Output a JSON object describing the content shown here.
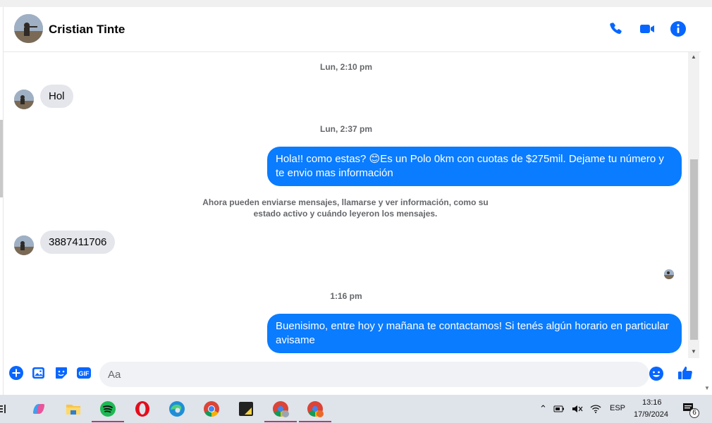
{
  "header": {
    "contact_name": "Cristian Tinte",
    "icons": [
      "phone-icon",
      "video-camera-icon",
      "info-icon"
    ]
  },
  "thread": {
    "timestamps": [
      "Lun, 2:10 pm",
      "Lun, 2:37 pm",
      "1:16 pm"
    ],
    "messages": [
      {
        "from": "contact",
        "text": "Hol"
      },
      {
        "from": "me",
        "text": "Hola!! como estas? 😊Es un Polo 0km con cuotas de $275mil. Dejame tu número y te envio mas información"
      },
      {
        "from": "contact",
        "text": "3887411706"
      },
      {
        "from": "me",
        "text": "Buenisimo, entre hoy y mañana te contactamos! Si tenés algún horario en particular avisame"
      }
    ],
    "system_notice": "Ahora pueden enviarse mensajes, llamarse y ver información, como su estado activo y cuándo leyeron los mensajes."
  },
  "composer": {
    "placeholder": "Aa",
    "icons": [
      "add-icon",
      "image-icon",
      "sticker-icon",
      "gif-icon",
      "emoji-icon",
      "like-icon"
    ],
    "gif_label": "GIF"
  },
  "taskbar": {
    "apps": [
      "copilot-icon",
      "file-explorer-icon",
      "spotify-icon",
      "opera-icon",
      "edge-icon",
      "chrome-icon",
      "sticky-notes-icon",
      "chrome-profile-icon",
      "chrome-profile-2-icon"
    ],
    "language": "ESP",
    "time": "13:16",
    "date": "17/9/2024",
    "notification_count": "6"
  },
  "colors": {
    "accent": "#0a7cff",
    "incoming_bubble": "#e4e6eb",
    "icon_blue": "#0866ff"
  }
}
